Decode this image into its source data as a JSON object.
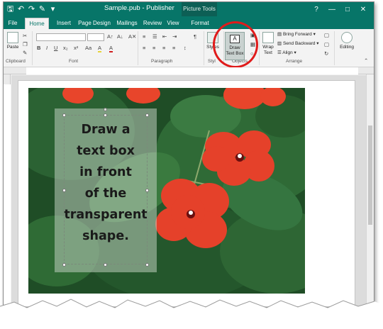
{
  "title_bar": {
    "document_title": "Sample.pub  -  Publisher",
    "context_tab": "Picture Tools",
    "qat_icons": [
      "save-icon",
      "undo-icon",
      "redo-icon",
      "format-painter-icon",
      "customize-icon"
    ],
    "window_controls": [
      "?",
      "—",
      "□",
      "✕"
    ]
  },
  "tabs": [
    {
      "label": "File"
    },
    {
      "label": "Home"
    },
    {
      "label": "Insert"
    },
    {
      "label": "Page Design"
    },
    {
      "label": "Mailings"
    },
    {
      "label": "Review"
    },
    {
      "label": "View"
    },
    {
      "label": "Format"
    }
  ],
  "active_tab": "Home",
  "ribbon": {
    "clipboard": {
      "paste_label": "Paste",
      "group_label": "Clipboard"
    },
    "font": {
      "group_label": "Font",
      "format_buttons": [
        "B",
        "I",
        "U",
        "x₂",
        "x²",
        "Aa",
        "A",
        "A"
      ]
    },
    "paragraph": {
      "group_label": "Paragraph",
      "pilcrow": "¶"
    },
    "styles": {
      "label": "Styles",
      "group_label": "Styl"
    },
    "objects": {
      "draw_text_box_line1": "Draw",
      "draw_text_box_line2": "Text Box",
      "group_label": "Objects"
    },
    "arrange": {
      "wrap_text_line1": "Wrap",
      "wrap_text_line2": "Text",
      "bring_forward": "Bring Forward",
      "send_backward": "Send Backward",
      "align": "Align",
      "group_label": "Arrange"
    },
    "editing": {
      "label": "Editing"
    }
  },
  "canvas": {
    "overlay_text": "Draw a\ntext box\nin front\nof the\ntransparent\nshape."
  },
  "colors": {
    "accent": "#077568",
    "highlight_circle": "#e01b1b"
  }
}
